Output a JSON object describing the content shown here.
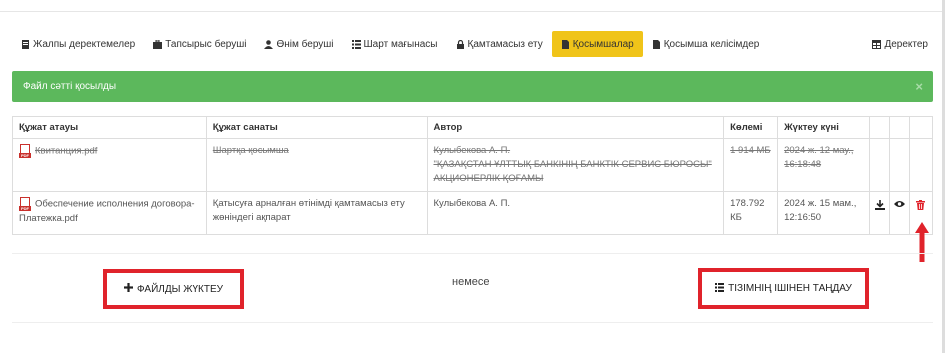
{
  "tabs": [
    {
      "label": "Жалпы деректемелер",
      "icon": "document-icon"
    },
    {
      "label": "Тапсырыс беруші",
      "icon": "briefcase-icon"
    },
    {
      "label": "Өнім беруші",
      "icon": "user-icon"
    },
    {
      "label": "Шарт мағынасы",
      "icon": "list-icon"
    },
    {
      "label": "Қамтамасыз ету",
      "icon": "lock-icon"
    },
    {
      "label": "Қосымшалар",
      "icon": "file-icon",
      "active": true
    },
    {
      "label": "Қосымша келісімдер",
      "icon": "file-icon"
    },
    {
      "label": "Деректер",
      "icon": "table-icon"
    }
  ],
  "alert": {
    "message": "Файл сәтті қосылды",
    "close": "×"
  },
  "table": {
    "headers": [
      "Құжат атауы",
      "Құжат санаты",
      "Автор",
      "Көлемі",
      "Жүктеу күні"
    ],
    "rows": [
      {
        "name": "Квитанция.pdf",
        "category": "Шартқа қосымша",
        "author_line1": "Кулыбекова А. П.",
        "author_line2": "\"ҚАЗАҚСТАН ҰЛТТЫҚ БАНКІНІҢ БАНКТІК СЕРВИС БЮРОСЫ\" АКЦИОНЕРЛІК ҚОҒАМЫ",
        "size": "1 914 МБ",
        "date": "2024 ж. 12 мау., 16:18:48",
        "deleted": true
      },
      {
        "name": "Обеспечение исполнения договора-Платежка.pdf",
        "category": "Қатысуға арналған өтінімді қамтамасыз ету жөніндегі ақпарат",
        "author_line1": "Кулыбекова А. П.",
        "author_line2": "",
        "size": "178.792 КБ",
        "date": "2024 ж. 15 мам., 12:16:50",
        "deleted": false
      }
    ]
  },
  "upload_button": "ФАЙЛДЫ ЖҮКТЕУ",
  "or_text": "немесе",
  "select_button": "ТІЗІМНІҢ ІШІНЕН ТАҢДАУ",
  "colors": {
    "accent": "#f0c419",
    "success": "#5cb85c",
    "highlight": "#e0232b"
  }
}
